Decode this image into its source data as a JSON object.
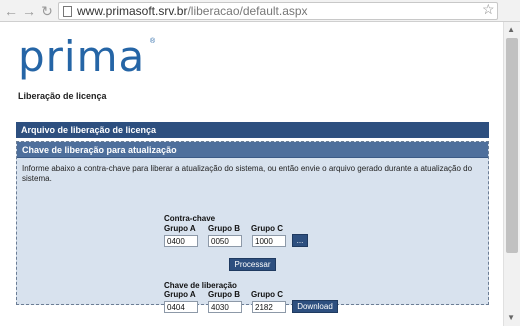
{
  "browser": {
    "url_domain": "www.primasoft.srv.br",
    "url_path": "/liberacao/default.aspx"
  },
  "logo": {
    "text": "prima",
    "registered": "®"
  },
  "page_title": "Liberação de licença",
  "arquivo_bar": {
    "label": "Arquivo de liberação de licença"
  },
  "chave_panel": {
    "title": "Chave de liberação para atualização",
    "instructions": "Informe abaixo a contra-chave para liberar a atualização do sistema, ou então envie o arquivo gerado durante a atualização do sistema.",
    "contra_chave": {
      "label": "Contra-chave",
      "group_a_label": "Grupo A",
      "group_b_label": "Grupo B",
      "group_c_label": "Grupo C",
      "group_a_value": "0400",
      "group_b_value": "0050",
      "group_c_value": "1000",
      "browse_label": "..."
    },
    "process_label": "Processar",
    "chave_liberacao": {
      "label": "Chave de liberação",
      "group_a_label": "Grupo A",
      "group_b_label": "Grupo B",
      "group_c_label": "Grupo C",
      "group_a_value": "0404",
      "group_b_value": "4030",
      "group_c_value": "2182",
      "download_label": "Download"
    }
  }
}
